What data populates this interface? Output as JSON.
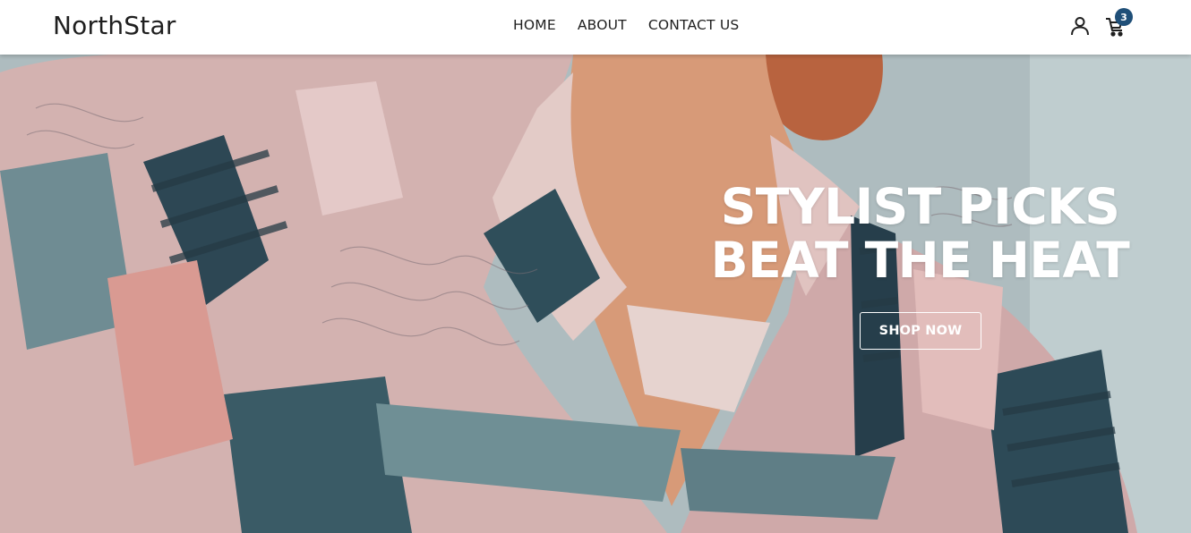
{
  "brand": {
    "name": "NorthStar"
  },
  "nav": {
    "items": [
      {
        "label": "HOME"
      },
      {
        "label": "ABOUT"
      },
      {
        "label": "CONTACT US"
      }
    ]
  },
  "header_icons": {
    "user_icon": "user-icon",
    "cart_icon": "cart-icon",
    "cart_count": "3"
  },
  "hero": {
    "headline": "STYLIST PICKS BEAT THE HEAT",
    "cta_label": "SHOP NOW"
  },
  "colors": {
    "badge": "#1f4f78",
    "text_dark": "#1f1f1f",
    "hero_text": "#ffffff"
  }
}
